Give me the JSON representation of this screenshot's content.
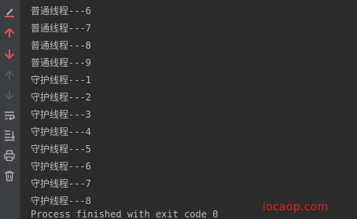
{
  "console": {
    "lines": [
      "普通线程---6",
      "普通线程---7",
      "普通线程---8",
      "普通线程---9",
      "守护线程---1",
      "守护线程---2",
      "守护线程---3",
      "守护线程---4",
      "守护线程---5",
      "守护线程---6",
      "守护线程---7",
      "守护线程---8"
    ],
    "exit_message": "Process finished with exit code 0"
  },
  "watermark": "iocaop.com",
  "toolbar": {
    "icons": [
      "rerun-icon",
      "arrow-up-icon",
      "arrow-down-icon",
      "arrow-up-disabled-icon",
      "arrow-down-disabled-icon",
      "soft-wrap-icon",
      "scroll-to-end-icon",
      "print-icon",
      "trash-icon"
    ]
  },
  "colors": {
    "background": "#2b2b2b",
    "gutter": "#3c3f41",
    "text": "#bbbbbb",
    "icon_red": "#e05252",
    "icon_gray": "#afb1b3",
    "icon_disabled": "#5a5d5f",
    "watermark": "#e2231a"
  }
}
